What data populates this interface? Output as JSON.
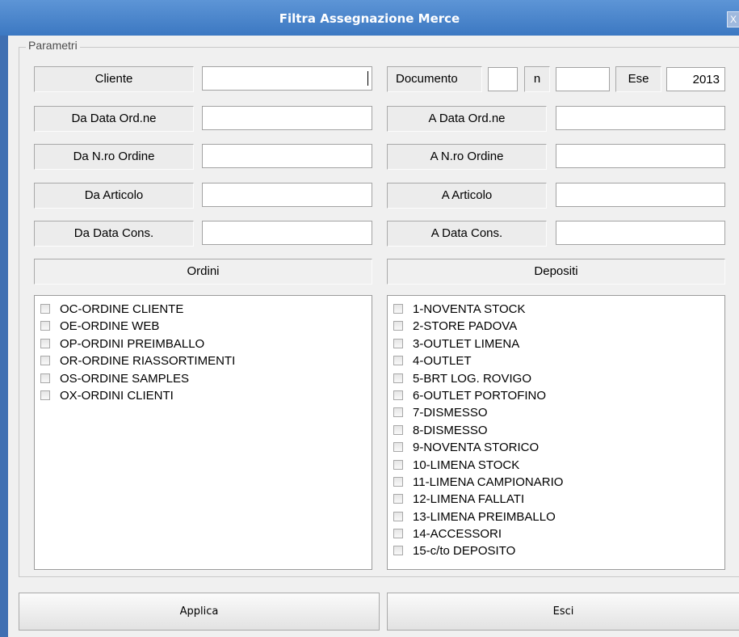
{
  "window": {
    "title": "Filtra Assegnazione Merce",
    "close_label": "X"
  },
  "params": {
    "legend": "Parametri",
    "cliente": {
      "label": "Cliente",
      "value": ""
    },
    "documento": {
      "label": "Documento",
      "value1": "",
      "n_label": "n",
      "value2": "",
      "ese_label": "Ese",
      "ese_value": "2013"
    },
    "da_data_ord": {
      "label": "Da Data Ord.ne",
      "value": ""
    },
    "a_data_ord": {
      "label": "A Data Ord.ne",
      "value": ""
    },
    "da_nro_ord": {
      "label": "Da N.ro Ordine",
      "value": ""
    },
    "a_nro_ord": {
      "label": "A N.ro Ordine",
      "value": ""
    },
    "da_articolo": {
      "label": "Da Articolo",
      "value": ""
    },
    "a_articolo": {
      "label": "A Articolo",
      "value": ""
    },
    "da_data_cons": {
      "label": "Da Data Cons.",
      "value": ""
    },
    "a_data_cons": {
      "label": "A Data Cons.",
      "value": ""
    }
  },
  "ordini": {
    "header": "Ordini",
    "items": [
      {
        "label": "OC-ORDINE CLIENTE",
        "checked": false
      },
      {
        "label": "OE-ORDINE WEB",
        "checked": false
      },
      {
        "label": "OP-ORDINI PREIMBALLO",
        "checked": false
      },
      {
        "label": "OR-ORDINE RIASSORTIMENTI",
        "checked": false
      },
      {
        "label": "OS-ORDINE SAMPLES",
        "checked": false
      },
      {
        "label": "OX-ORDINI CLIENTI",
        "checked": false
      }
    ]
  },
  "depositi": {
    "header": "Depositi",
    "items": [
      {
        "label": "1-NOVENTA STOCK",
        "checked": false
      },
      {
        "label": "2-STORE PADOVA",
        "checked": false
      },
      {
        "label": "3-OUTLET LIMENA",
        "checked": false
      },
      {
        "label": "4-OUTLET",
        "checked": false
      },
      {
        "label": "5-BRT LOG. ROVIGO",
        "checked": false
      },
      {
        "label": "6-OUTLET PORTOFINO",
        "checked": false
      },
      {
        "label": "7-DISMESSO",
        "checked": false
      },
      {
        "label": "8-DISMESSO",
        "checked": false
      },
      {
        "label": "9-NOVENTA STORICO",
        "checked": false
      },
      {
        "label": "10-LIMENA STOCK",
        "checked": false
      },
      {
        "label": "11-LIMENA CAMPIONARIO",
        "checked": false
      },
      {
        "label": "12-LIMENA FALLATI",
        "checked": false
      },
      {
        "label": "13-LIMENA PREIMBALLO",
        "checked": false
      },
      {
        "label": "14-ACCESSORI",
        "checked": false
      },
      {
        "label": "15-c/to DEPOSITO",
        "checked": false
      }
    ]
  },
  "buttons": {
    "apply": "Applica",
    "exit": "Esci"
  }
}
